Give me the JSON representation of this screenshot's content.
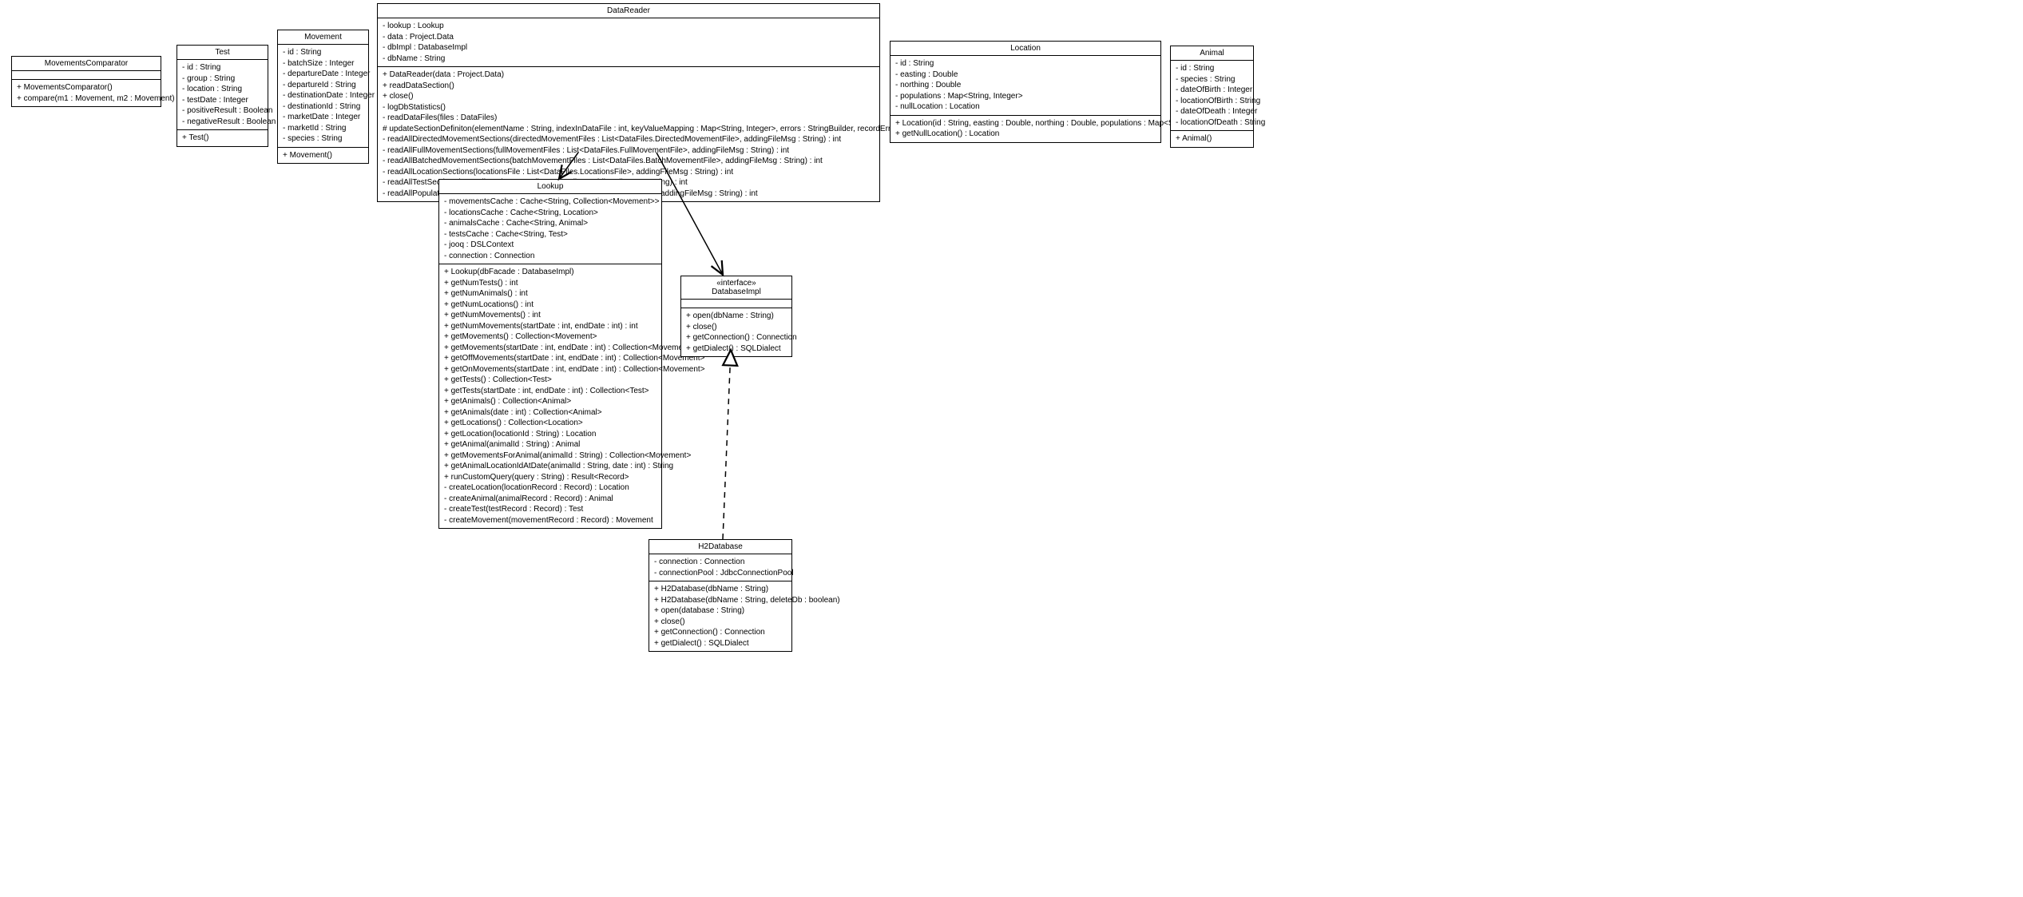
{
  "classes": {
    "movementsComparator": {
      "name": "MovementsComparator",
      "attrs": [],
      "ops": [
        "+ MovementsComparator()",
        "+ compare(m1 : Movement, m2 : Movement) : int"
      ]
    },
    "test": {
      "name": "Test",
      "attrs": [
        "- id : String",
        "- group : String",
        "- location : String",
        "- testDate : Integer",
        "- positiveResult : Boolean",
        "- negativeResult : Boolean"
      ],
      "ops": [
        "+ Test()"
      ]
    },
    "movement": {
      "name": "Movement",
      "attrs": [
        "- id : String",
        "- batchSize : Integer",
        "- departureDate : Integer",
        "- departureId : String",
        "- destinationDate : Integer",
        "- destinationId : String",
        "- marketDate : Integer",
        "- marketId : String",
        "- species : String"
      ],
      "ops": [
        "+ Movement()"
      ]
    },
    "dataReader": {
      "name": "DataReader",
      "attrs": [
        "- lookup : Lookup",
        "- data : Project.Data",
        "- dbImpl : DatabaseImpl",
        "- dbName : String"
      ],
      "ops": [
        "+ DataReader(data : Project.Data)",
        "+ readDataSection()",
        "+ close()",
        "- logDbStatistics()",
        "- readDataFiles(files : DataFiles)",
        "# updateSectionDefiniton(elementName : String, indexInDataFile : int, keyValueMapping : Map<String, Integer>, errors : StringBuilder, recordErrors : boolean, sectionName : String)",
        "- readAllDirectedMovementSections(directedMovementFiles : List<DataFiles.DirectedMovementFile>, addingFileMsg : String) : int",
        "- readAllFullMovementSections(fullMovementFiles : List<DataFiles.FullMovementFile>, addingFileMsg : String) : int",
        "- readAllBatchedMovementSections(batchMovementFiles : List<DataFiles.BatchMovementFile>, addingFileMsg : String) : int",
        "- readAllLocationSections(locationsFile : List<DataFiles.LocationsFile>, addingFileMsg : String) : int",
        "- readAllTestSections(testsFile : List<DataFiles.TestsFile>, addingFileMsg : String) : int",
        "- readAllPopulationSections(populationsFiles : List<DataFiles.PopulationFile>, addingFileMsg : String) : int"
      ]
    },
    "location": {
      "name": "Location",
      "attrs": [
        "- id : String",
        "- easting : Double",
        "- northing : Double",
        "- populations : Map<String, Integer>",
        "- nullLocation : Location"
      ],
      "ops": [
        "+ Location(id : String, easting : Double, northing : Double, populations : Map<String, Integer>)",
        "+ getNullLocation() : Location"
      ]
    },
    "animal": {
      "name": "Animal",
      "attrs": [
        "- id : String",
        "- species : String",
        "- dateOfBirth : Integer",
        "- locationOfBirth : String",
        "- dateOfDeath : Integer",
        "- locationOfDeath : String"
      ],
      "ops": [
        "+ Animal()"
      ]
    },
    "lookup": {
      "name": "Lookup",
      "attrs": [
        "- movementsCache : Cache<String, Collection<Movement>>",
        "- locationsCache : Cache<String, Location>",
        "- animalsCache : Cache<String, Animal>",
        "- testsCache : Cache<String, Test>",
        "- jooq : DSLContext",
        "- connection : Connection"
      ],
      "ops": [
        "+ Lookup(dbFacade : DatabaseImpl)",
        "+ getNumTests() : int",
        "+ getNumAnimals() : int",
        "+ getNumLocations() : int",
        "+ getNumMovements() : int",
        "+ getNumMovements(startDate : int, endDate : int) : int",
        "+ getMovements() : Collection<Movement>",
        "+ getMovements(startDate : int, endDate : int) : Collection<Movement>",
        "+ getOffMovements(startDate : int, endDate : int) : Collection<Movement>",
        "+ getOnMovements(startDate : int, endDate : int) : Collection<Movement>",
        "+ getTests() : Collection<Test>",
        "+ getTests(startDate : int, endDate : int) : Collection<Test>",
        "+ getAnimals() : Collection<Animal>",
        "+ getAnimals(date : int) : Collection<Animal>",
        "+ getLocations() : Collection<Location>",
        "+ getLocation(locationId : String) : Location",
        "+ getAnimal(animalId : String) : Animal",
        "+ getMovementsForAnimal(animalId : String) : Collection<Movement>",
        "+ getAnimalLocationIdAtDate(animalId : String, date : int) : String",
        "+ runCustomQuery(query : String) : Result<Record>",
        "- createLocation(locationRecord : Record) : Location",
        "- createAnimal(animalRecord : Record) : Animal",
        "- createTest(testRecord : Record) : Test",
        "- createMovement(movementRecord : Record) : Movement"
      ]
    },
    "databaseImpl": {
      "stereotype": "«interface»",
      "name": "DatabaseImpl",
      "attrs": [],
      "ops": [
        "+ open(dbName : String)",
        "+ close()",
        "+ getConnection() : Connection",
        "+ getDialect() : SQLDialect"
      ]
    },
    "h2Database": {
      "name": "H2Database",
      "attrs": [
        "- connection : Connection",
        "- connectionPool : JdbcConnectionPool"
      ],
      "ops": [
        "+ H2Database(dbName : String)",
        "+ H2Database(dbName : String, deleteDb : boolean)",
        "+ open(database : String)",
        "+ close()",
        "+ getConnection() : Connection",
        "+ getDialect() : SQLDialect"
      ]
    }
  }
}
